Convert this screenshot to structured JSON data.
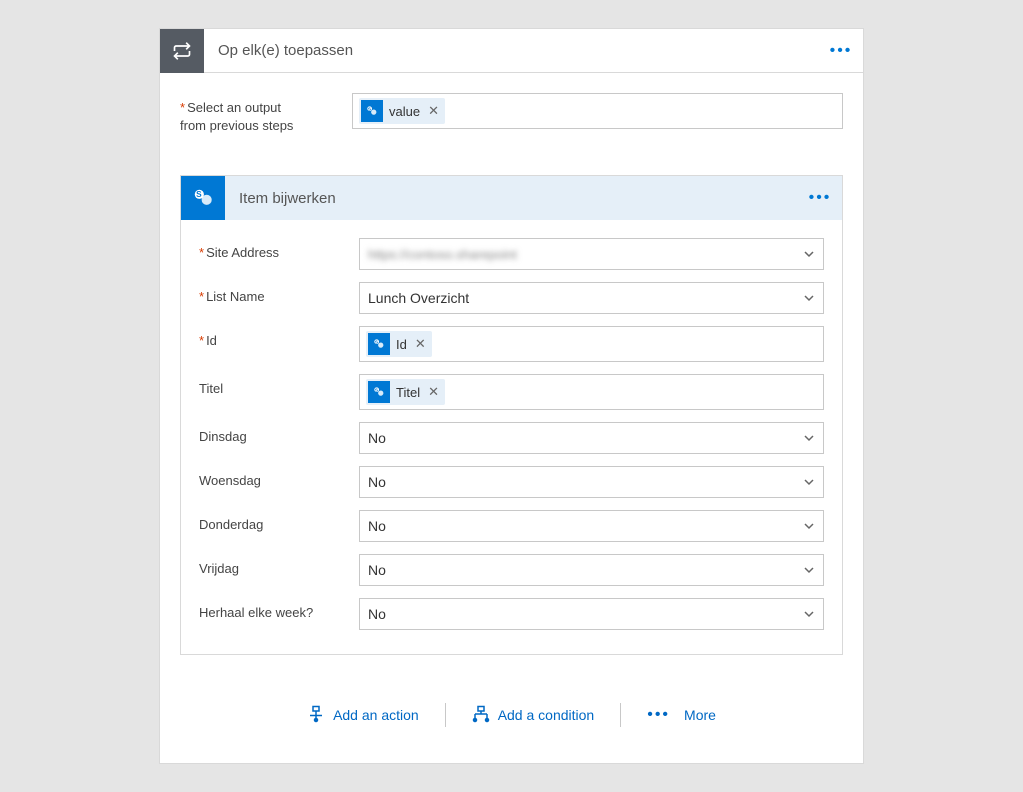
{
  "outer": {
    "title": "Op elk(e) toepassen",
    "param_label_line1": "Select an output",
    "param_label_line2": "from previous steps",
    "token_value": "value"
  },
  "inner": {
    "title": "Item bijwerken",
    "fields": {
      "site_address": {
        "label": "Site Address",
        "value": "https://contoso.sharepoint"
      },
      "list_name": {
        "label": "List Name",
        "value": "Lunch Overzicht"
      },
      "id": {
        "label": "Id",
        "token": "Id"
      },
      "titel": {
        "label": "Titel",
        "token": "Titel"
      },
      "dinsdag": {
        "label": "Dinsdag",
        "value": "No"
      },
      "woensdag": {
        "label": "Woensdag",
        "value": "No"
      },
      "donderdag": {
        "label": "Donderdag",
        "value": "No"
      },
      "vrijdag": {
        "label": "Vrijdag",
        "value": "No"
      },
      "herhaal": {
        "label": "Herhaal elke week?",
        "value": "No"
      }
    }
  },
  "footer": {
    "add_action": "Add an action",
    "add_condition": "Add a condition",
    "more": "More"
  }
}
